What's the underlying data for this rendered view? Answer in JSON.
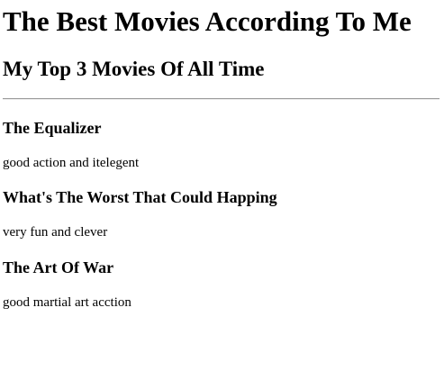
{
  "page": {
    "title": "The Best Movies According To Me",
    "subtitle": "My Top 3 Movies Of All Time"
  },
  "movies": [
    {
      "title": "The Equalizer",
      "description": "good action and itelegent"
    },
    {
      "title": "What's The Worst That Could Happing",
      "description": "very fun and clever"
    },
    {
      "title": "The Art Of War",
      "description": "good martial art acction"
    }
  ]
}
